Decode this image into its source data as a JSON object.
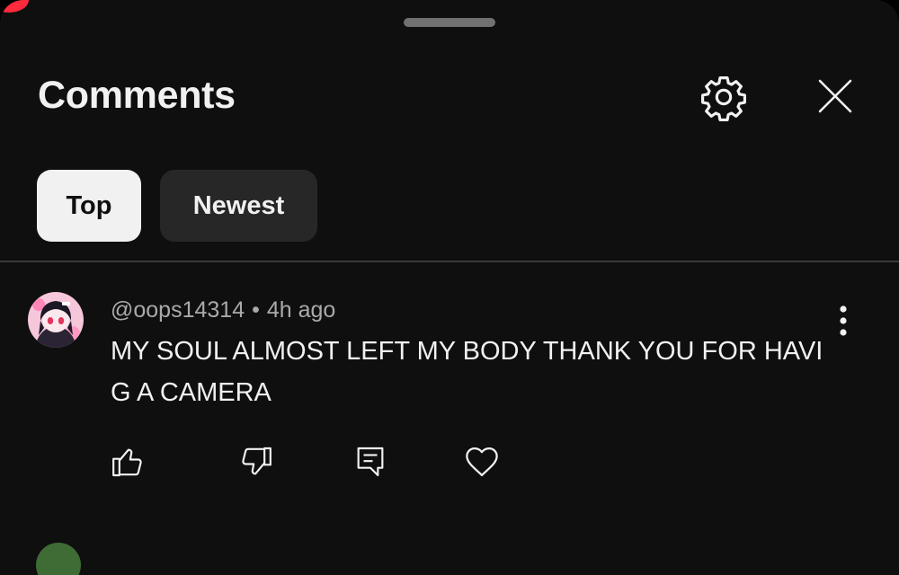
{
  "header": {
    "title": "Comments",
    "settings_icon": "gear-icon",
    "close_icon": "close-icon"
  },
  "sort": {
    "chips": [
      {
        "label": "Top",
        "selected": true
      },
      {
        "label": "Newest",
        "selected": false
      }
    ]
  },
  "comments": [
    {
      "author": "@oops14314",
      "separator": "•",
      "time": "4h ago",
      "text": "MY SOUL ALMOST LEFT MY BODY THANK YOU FOR HAVI G A CAMERA",
      "actions": [
        "thumbs-up-icon",
        "thumbs-down-icon",
        "reply-icon",
        "heart-icon"
      ]
    }
  ],
  "colors": {
    "background": "#0f0f0f",
    "text_primary": "#f1f1f1",
    "text_secondary": "#aaaaaa",
    "chip_selected_bg": "#f1f1f1",
    "chip_bg": "#272727",
    "record_indicator": "#ff2a3c"
  }
}
